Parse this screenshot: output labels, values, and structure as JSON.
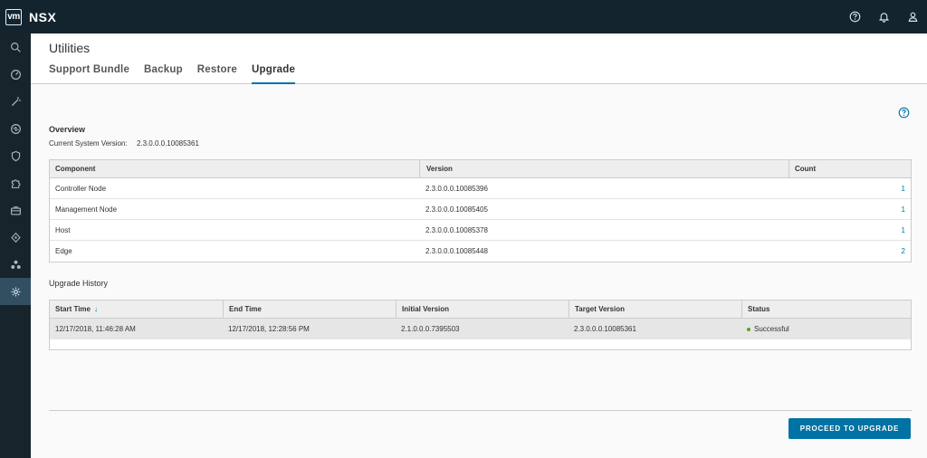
{
  "header": {
    "logo_text": "vm",
    "app_name": "NSX",
    "icons": [
      "help-icon",
      "bell-icon",
      "user-icon"
    ]
  },
  "sidenav": {
    "items": [
      {
        "icon": "search-icon"
      },
      {
        "icon": "dashboard-icon"
      },
      {
        "icon": "wand-icon"
      },
      {
        "icon": "network-icon"
      },
      {
        "icon": "shield-icon"
      },
      {
        "icon": "puzzle-icon"
      },
      {
        "icon": "inventory-icon"
      },
      {
        "icon": "tools-icon"
      },
      {
        "icon": "cluster-icon"
      },
      {
        "icon": "system-gear-icon",
        "active": true
      }
    ]
  },
  "page": {
    "title": "Utilities",
    "tabs": [
      {
        "label": "Support Bundle"
      },
      {
        "label": "Backup"
      },
      {
        "label": "Restore"
      },
      {
        "label": "Upgrade",
        "active": true
      }
    ]
  },
  "overview": {
    "title": "Overview",
    "version_label": "Current System Version:",
    "version_value": "2.3.0.0.0.10085361",
    "columns": [
      "Component",
      "Version",
      "Count"
    ],
    "rows": [
      {
        "component": "Controller Node",
        "version": "2.3.0.0.0.10085396",
        "count": "1"
      },
      {
        "component": "Management Node",
        "version": "2.3.0.0.0.10085405",
        "count": "1"
      },
      {
        "component": "Host",
        "version": "2.3.0.0.0.10085378",
        "count": "1"
      },
      {
        "component": "Edge",
        "version": "2.3.0.0.0.10085448",
        "count": "2"
      }
    ]
  },
  "history": {
    "title": "Upgrade History",
    "columns": [
      "Start Time",
      "End Time",
      "Initial Version",
      "Target Version",
      "Status"
    ],
    "sort_arrow": "↓",
    "rows": [
      {
        "start": "12/17/2018, 11:46:28 AM",
        "end": "12/17/2018, 12:28:56 PM",
        "initial": "2.1.0.0.0.7395503",
        "target": "2.3.0.0.0.10085361",
        "status": "Successful"
      }
    ]
  },
  "footer": {
    "proceed_label": "PROCEED TO UPGRADE"
  },
  "colors": {
    "header_bg": "#13242f",
    "nav_bg": "#17242b",
    "nav_active": "#324f61",
    "accent": "#0072a3",
    "success": "#5aa220"
  }
}
